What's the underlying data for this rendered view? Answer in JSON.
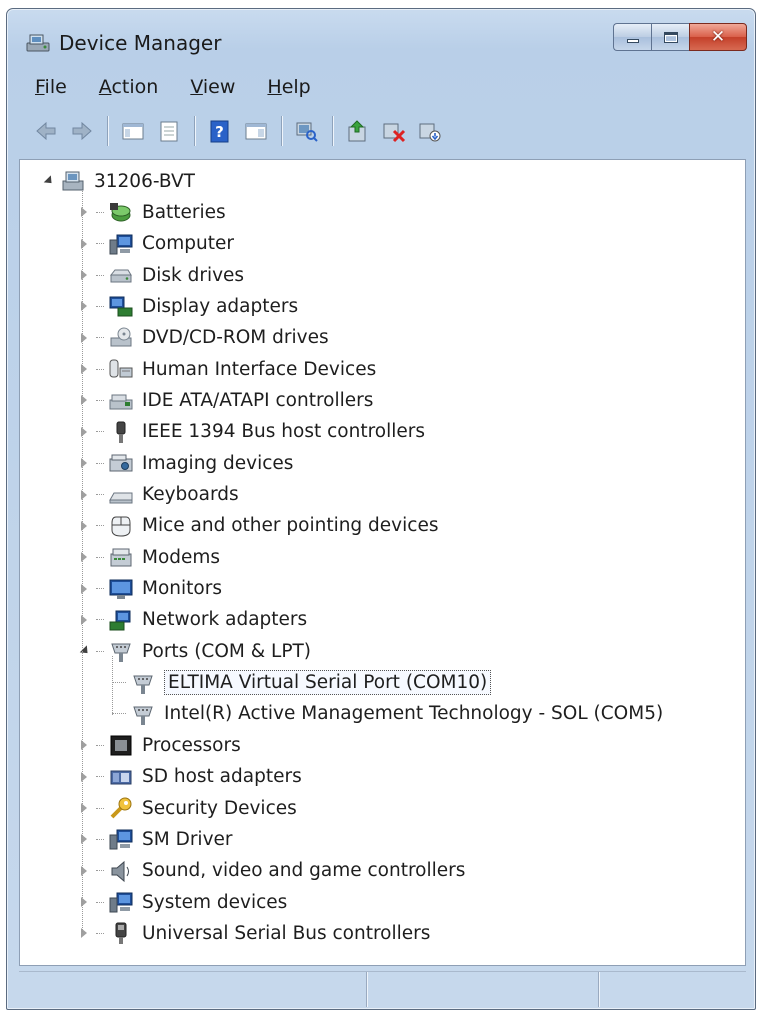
{
  "window": {
    "title": "Device Manager"
  },
  "menu": [
    {
      "label": "File",
      "accel": "F",
      "rest": "ile"
    },
    {
      "label": "Action",
      "accel": "A",
      "rest": "ction"
    },
    {
      "label": "View",
      "accel": "V",
      "rest": "iew"
    },
    {
      "label": "Help",
      "accel": "H",
      "rest": "elp"
    }
  ],
  "toolbar": [
    {
      "name": "back-button",
      "icon": "arrow-left-icon"
    },
    {
      "name": "forward-button",
      "icon": "arrow-right-icon"
    },
    {
      "name": "show-hide-console-tree-button",
      "icon": "console-tree-icon"
    },
    {
      "name": "properties-button",
      "icon": "properties-icon"
    },
    {
      "name": "help-button",
      "icon": "help-icon"
    },
    {
      "name": "show-action-pane-button",
      "icon": "action-pane-icon"
    },
    {
      "name": "scan-hardware-button",
      "icon": "scan-hardware-icon"
    },
    {
      "name": "update-driver-button",
      "icon": "update-driver-icon"
    },
    {
      "name": "uninstall-button",
      "icon": "uninstall-icon"
    },
    {
      "name": "disable-button",
      "icon": "disable-icon"
    }
  ],
  "tree": {
    "root": "31206-BVT",
    "categories": [
      {
        "label": "Batteries",
        "icon": "battery-icon"
      },
      {
        "label": "Computer",
        "icon": "computer-icon"
      },
      {
        "label": "Disk drives",
        "icon": "disk-drive-icon"
      },
      {
        "label": "Display adapters",
        "icon": "display-adapter-icon"
      },
      {
        "label": "DVD/CD-ROM drives",
        "icon": "dvd-drive-icon"
      },
      {
        "label": "Human Interface Devices",
        "icon": "hid-icon"
      },
      {
        "label": "IDE ATA/ATAPI controllers",
        "icon": "ide-controller-icon"
      },
      {
        "label": "IEEE 1394 Bus host controllers",
        "icon": "ieee1394-icon"
      },
      {
        "label": "Imaging devices",
        "icon": "imaging-device-icon"
      },
      {
        "label": "Keyboards",
        "icon": "keyboard-icon"
      },
      {
        "label": "Mice and other pointing devices",
        "icon": "mouse-icon"
      },
      {
        "label": "Modems",
        "icon": "modem-icon"
      },
      {
        "label": "Monitors",
        "icon": "monitor-icon"
      },
      {
        "label": "Network adapters",
        "icon": "network-adapter-icon"
      },
      {
        "label": "Ports (COM & LPT)",
        "icon": "port-icon",
        "expanded": true,
        "children": [
          {
            "label": "ELTIMA Virtual Serial Port (COM10)",
            "icon": "port-icon",
            "selected": true
          },
          {
            "label": "Intel(R) Active Management Technology - SOL (COM5)",
            "icon": "port-icon"
          }
        ]
      },
      {
        "label": "Processors",
        "icon": "processor-icon"
      },
      {
        "label": "SD host adapters",
        "icon": "sd-host-icon"
      },
      {
        "label": "Security Devices",
        "icon": "security-device-icon"
      },
      {
        "label": "SM Driver",
        "icon": "sm-driver-icon"
      },
      {
        "label": "Sound, video and game controllers",
        "icon": "sound-icon"
      },
      {
        "label": "System devices",
        "icon": "system-device-icon"
      },
      {
        "label": "Universal Serial Bus controllers",
        "icon": "usb-icon"
      }
    ]
  }
}
